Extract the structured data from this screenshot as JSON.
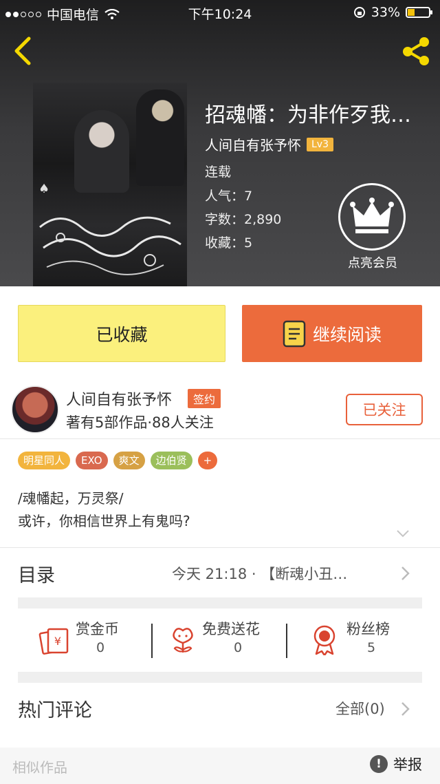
{
  "status_bar": {
    "carrier": "中国电信",
    "time": "下午10:24",
    "battery": "33%"
  },
  "book": {
    "title": "招魂幡：为非作歹我…",
    "author": "人间自有张予怀",
    "level": "Lv3",
    "status": "连载",
    "popularity": "人气：7",
    "word_count": "字数：2,890",
    "favorites": "收藏：5"
  },
  "vip_label": "点亮会员",
  "buttons": {
    "collected": "已收藏",
    "continue_reading": "继续阅读"
  },
  "author_card": {
    "name": "人间自有张予怀",
    "badge": "签约",
    "stats": "著有5部作品·88人关注",
    "follow": "已关注"
  },
  "tags": [
    {
      "label": "明星同人",
      "color": "#f2b43d"
    },
    {
      "label": "EXO",
      "color": "#d9694f"
    },
    {
      "label": "爽文",
      "color": "#d6a144"
    },
    {
      "label": "边伯贤",
      "color": "#9bbf5b"
    },
    {
      "label": "+",
      "color": "#ec6b3c"
    }
  ],
  "intro": {
    "line1": "/魂幡起，万灵祭/",
    "line2": "或许，你相信世界上有鬼吗?"
  },
  "toc": {
    "label": "目录",
    "latest": "今天 21:18 · 【断魂小丑…"
  },
  "actions": [
    {
      "label": "赏金币",
      "count": "0"
    },
    {
      "label": "免费送花",
      "count": "0"
    },
    {
      "label": "粉丝榜",
      "count": "5"
    }
  ],
  "comments": {
    "label": "热门评论",
    "all": "全部(0)"
  },
  "footer": {
    "similar": "相似作品",
    "report": "举报",
    "report_icon": "!"
  },
  "colors": {
    "accent": "#ec6b3c",
    "collected_bg": "#fbf07d",
    "level_badge": "#f2b43d",
    "icon_red": "#d9432f"
  }
}
